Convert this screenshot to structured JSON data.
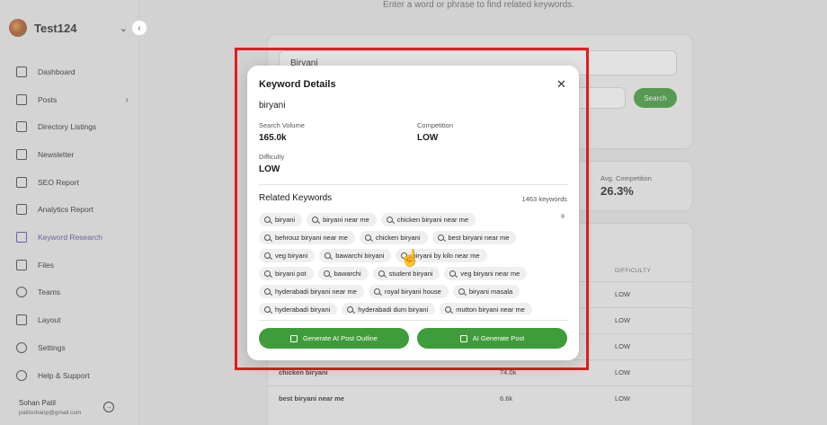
{
  "sidebar": {
    "workspace": "Test124",
    "items": [
      {
        "label": "Dashboard"
      },
      {
        "label": "Posts"
      },
      {
        "label": "Directory Listings"
      },
      {
        "label": "Newsletter"
      },
      {
        "label": "SEO Report"
      },
      {
        "label": "Analytics Report"
      },
      {
        "label": "Keyword Research"
      },
      {
        "label": "Files"
      },
      {
        "label": "Teams"
      },
      {
        "label": "Layout"
      },
      {
        "label": "Settings"
      },
      {
        "label": "Help & Support"
      }
    ],
    "active_item": "Keyword Research",
    "user": {
      "name": "Sohan Patil",
      "email": "patilsohanp@gmail.com"
    }
  },
  "main": {
    "hint": "Enter a word or phrase to find related keywords.",
    "search_value": "Biryani",
    "search_button": "Search",
    "avg_competition_label": "Avg. Competition",
    "avg_competition_value": "26.3%",
    "difficulty_header": "DIFFICULTY",
    "rows": [
      {
        "keyword": "",
        "volume": "",
        "difficulty": "LOW"
      },
      {
        "keyword": "",
        "volume": "",
        "difficulty": "LOW"
      },
      {
        "keyword": "",
        "volume": "",
        "difficulty": "LOW"
      },
      {
        "keyword": "chicken biryani",
        "volume": "74.0k",
        "difficulty": "LOW"
      },
      {
        "keyword": "best biryani near me",
        "volume": "6.6k",
        "difficulty": "LOW"
      }
    ]
  },
  "modal": {
    "title": "Keyword Details",
    "close_icon": "close-icon",
    "keyword": "biryani",
    "search_volume_label": "Search Volume",
    "search_volume_value": "165.0k",
    "competition_label": "Competition",
    "competition_value": "LOW",
    "difficulty_label": "Difficulty",
    "difficulty_value": "LOW",
    "related_title": "Related Keywords",
    "related_count": "1463 keywords",
    "related_rows": [
      [
        "biryani",
        "biryani near me",
        "chicken biryani near me"
      ],
      [
        "behrouz biryani near me",
        "chicken biryani",
        "best biryani near me"
      ],
      [
        "veg biryani",
        "bawarchi biryani",
        "biryani by kilo near me"
      ],
      [
        "biryani pot",
        "bawarchi",
        "student biryani",
        "veg biryani near me"
      ],
      [
        "hyderabadi biryani near me",
        "royal biryani house",
        "biryani masala"
      ],
      [
        "hyderabadi biryani",
        "hyderabadi dum biryani",
        "mutton biryani near me"
      ]
    ],
    "outline_button": "Generate AI Post Outline",
    "post_button": "AI Generate Post"
  },
  "colors": {
    "accent_green": "#3f9c3a",
    "highlight_red": "#e21d1d",
    "active_purple": "#5b4fa8"
  }
}
